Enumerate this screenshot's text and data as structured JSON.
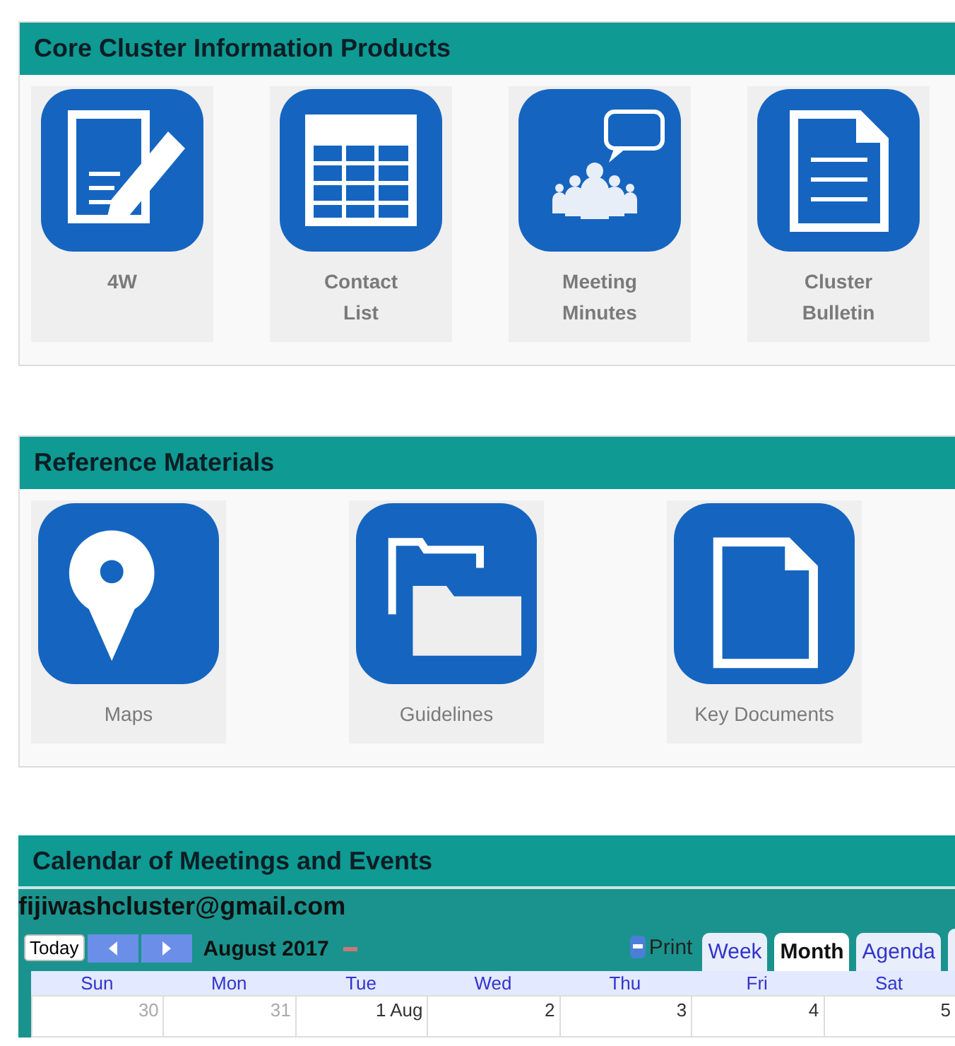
{
  "sections": [
    {
      "title": "Core Cluster Information Products",
      "tiles": [
        {
          "label": "4W",
          "kind": "edit"
        },
        {
          "label": "Contact List",
          "kind": "table"
        },
        {
          "label": "Meeting Minutes",
          "kind": "meeting"
        },
        {
          "label": "Cluster Bulletin",
          "kind": "bulletin"
        }
      ]
    },
    {
      "title": "Reference Materials",
      "tiles": [
        {
          "label": "Maps",
          "kind": "pin"
        },
        {
          "label": "Guidelines",
          "kind": "folders"
        },
        {
          "label": "Key Documents",
          "kind": "document"
        }
      ]
    }
  ],
  "calendar": {
    "title": "Calendar of Meetings and Events",
    "account": "fijiwashcluster@gmail.com",
    "today": "Today",
    "month": "August 2017",
    "print": "Print",
    "views": [
      {
        "label": "Week",
        "selected": false
      },
      {
        "label": "Month",
        "selected": true
      },
      {
        "label": "Agenda",
        "selected": false
      }
    ],
    "weekdays": [
      "Sun",
      "Mon",
      "Tue",
      "Wed",
      "Thu",
      "Fri",
      "Sat"
    ],
    "days": [
      {
        "label": "30",
        "other_month": true
      },
      {
        "label": "31",
        "other_month": true
      },
      {
        "label": "1 Aug",
        "other_month": false
      },
      {
        "label": "2",
        "other_month": false
      },
      {
        "label": "3",
        "other_month": false
      },
      {
        "label": "4",
        "other_month": false
      },
      {
        "label": "5",
        "other_month": false
      }
    ]
  }
}
